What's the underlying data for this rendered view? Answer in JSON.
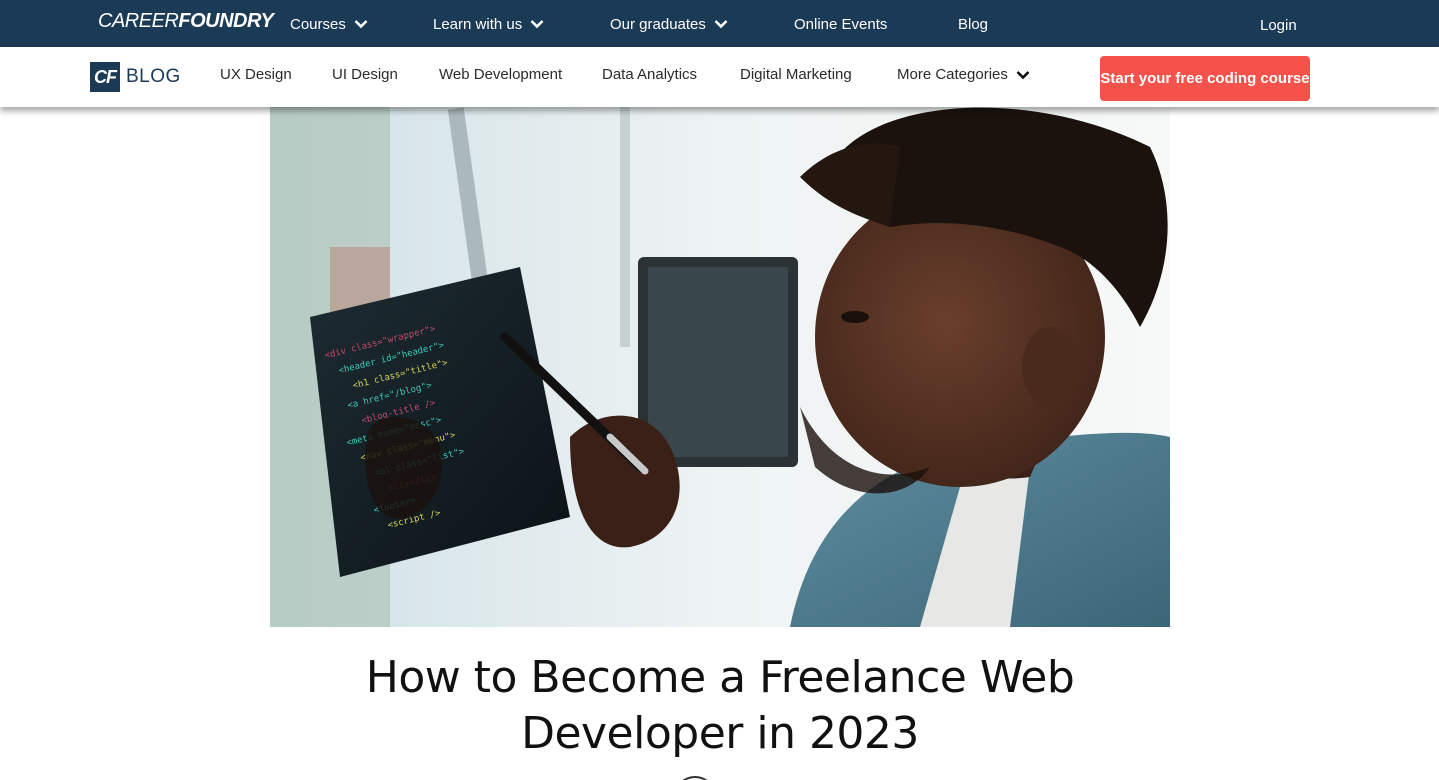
{
  "topnav": {
    "logo_regular": "CAREER",
    "logo_bold": "FOUNDRY",
    "items": [
      {
        "label": "Courses",
        "has_dropdown": true
      },
      {
        "label": "Learn with us",
        "has_dropdown": true
      },
      {
        "label": "Our graduates",
        "has_dropdown": true
      },
      {
        "label": "Online Events",
        "has_dropdown": false
      },
      {
        "label": "Blog",
        "has_dropdown": false
      }
    ],
    "login_label": "Login"
  },
  "blognav": {
    "logo_mark": "CF",
    "logo_text": "BLOG",
    "items": [
      {
        "label": "UX Design"
      },
      {
        "label": "UI Design"
      },
      {
        "label": "Web Development"
      },
      {
        "label": "Data Analytics"
      },
      {
        "label": "Digital Marketing"
      },
      {
        "label": "More Categories",
        "has_dropdown": true
      }
    ],
    "cta_label": "Start your free coding course"
  },
  "article": {
    "title": "How to Become a Freelance Web Developer in 2023"
  },
  "colors": {
    "topbar_bg": "#1b3a55",
    "cta_bg": "#f5524b",
    "text_dark": "#111111"
  }
}
